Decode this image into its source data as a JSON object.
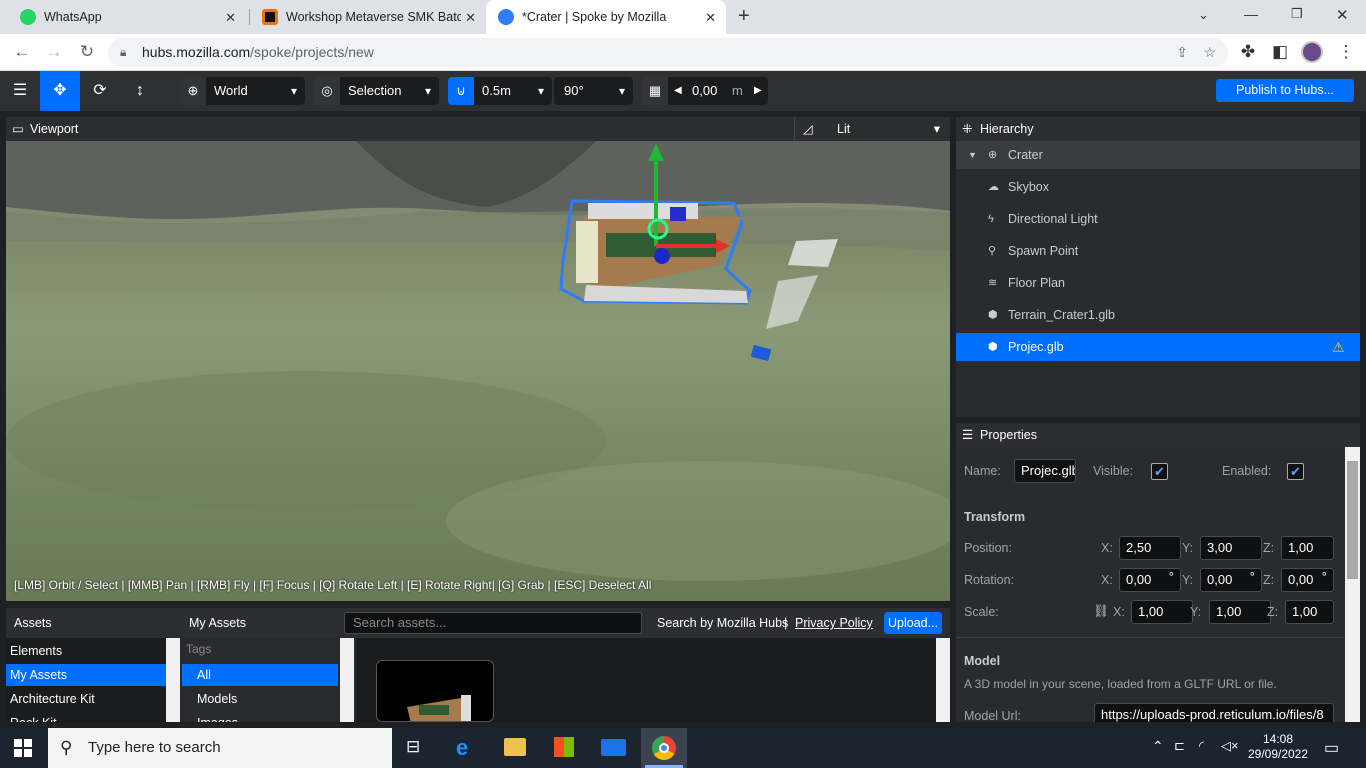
{
  "browser": {
    "tabs": [
      {
        "title": "WhatsApp",
        "icon": "whatsapp-icon"
      },
      {
        "title": "Workshop Metaverse SMK Batch",
        "icon": "workshop-icon"
      },
      {
        "title": "*Crater | Spoke by Mozilla",
        "icon": "spoke-icon"
      }
    ],
    "url_domain": "hubs.mozilla.com",
    "url_path": "/spoke/projects/new"
  },
  "toolbar": {
    "space_label": "World",
    "pivot_label": "Selection",
    "snap_distance": "0.5m",
    "snap_angle": "90°",
    "grid_height": "0,00",
    "grid_unit": "m",
    "publish_label": "Publish to Hubs..."
  },
  "viewport": {
    "title": "Viewport",
    "render_mode": "Lit",
    "hint": "[LMB] Orbit / Select | [MMB] Pan | [RMB] Fly | [F] Focus | [Q] Rotate Left | [E] Rotate Right| [G] Grab | [ESC] Deselect All"
  },
  "hierarchy": {
    "title": "Hierarchy",
    "root": "Crater",
    "items": [
      {
        "label": "Skybox",
        "icon": "cloud-icon"
      },
      {
        "label": "Directional Light",
        "icon": "bolt-icon"
      },
      {
        "label": "Spawn Point",
        "icon": "person-icon"
      },
      {
        "label": "Floor Plan",
        "icon": "shoe-prints-icon"
      },
      {
        "label": "Terrain_Crater1.glb",
        "icon": "cube-icon"
      },
      {
        "label": "Projec.glb",
        "icon": "cube-icon",
        "selected": true
      }
    ]
  },
  "properties": {
    "title": "Properties",
    "name_label": "Name:",
    "name_value": "Projec.glb",
    "visible_label": "Visible:",
    "enabled_label": "Enabled:",
    "transform_label": "Transform",
    "position_label": "Position:",
    "rotation_label": "Rotation:",
    "scale_label": "Scale:",
    "position": {
      "x": "2,50",
      "y": "3,00",
      "z": "1,00"
    },
    "rotation": {
      "x": "0,00",
      "y": "0,00",
      "z": "0,00"
    },
    "scale": {
      "x": "1,00",
      "y": "1,00",
      "z": "1,00"
    },
    "deg": "°",
    "model_label": "Model",
    "model_desc": "A 3D model in your scene, loaded from a GLTF URL or file.",
    "model_url_label": "Model Url:",
    "model_url_value": "https://uploads-prod.reticulum.io/files/8"
  },
  "assets": {
    "title": "Assets",
    "my_assets_title": "My Assets",
    "search_placeholder": "Search assets...",
    "search_by": "Search by Mozilla Hubs",
    "separator": "|",
    "privacy": "Privacy Policy",
    "upload": "Upload...",
    "sources": [
      "Elements",
      "My Assets",
      "Architecture Kit",
      "Rock Kit"
    ],
    "tags_header": "Tags",
    "tags": [
      "All",
      "Models",
      "Images"
    ]
  },
  "taskbar": {
    "search_placeholder": "Type here to search",
    "time": "14:08",
    "date": "29/09/2022"
  },
  "colors": {
    "accent": "#006eff",
    "warning": "#ffcc00"
  }
}
